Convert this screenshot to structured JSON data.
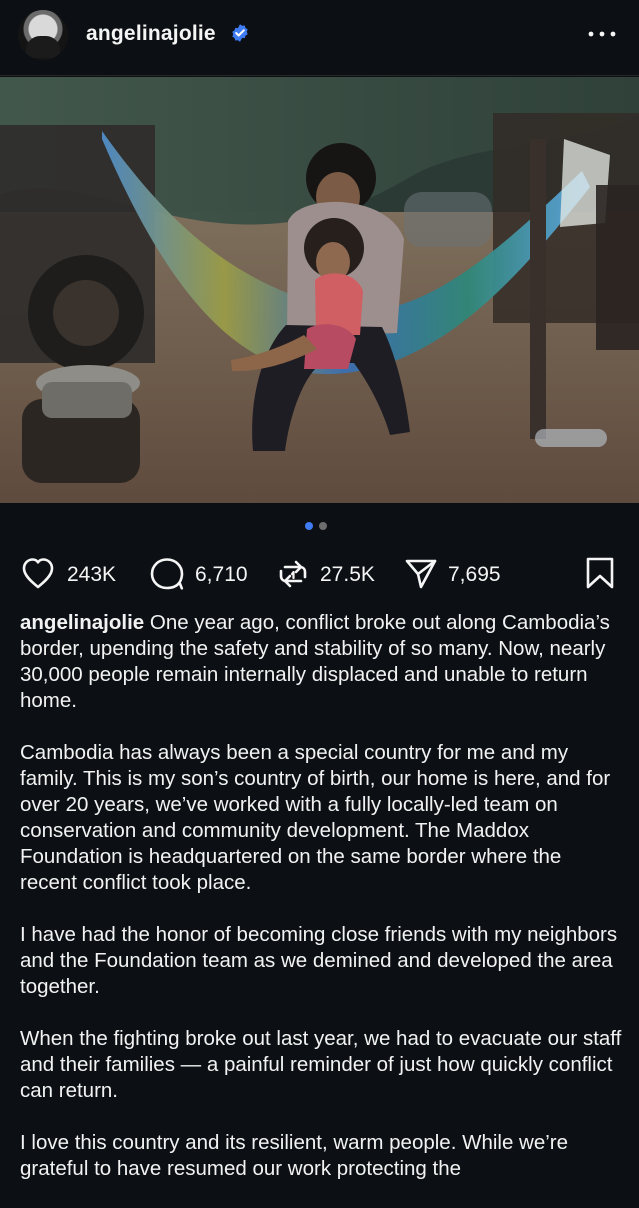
{
  "header": {
    "username": "angelinajolie",
    "verified_icon": "verified-badge-icon",
    "more_icon": "more-horizontal-icon"
  },
  "post": {
    "image_alt": "A mother holds a young child while sitting in a striped hammock under a tarp beside a truck, with a cooking pot on the ground.",
    "carousel": {
      "count": 2,
      "active_index": 0
    }
  },
  "actions": {
    "likes": "243K",
    "comments": "6,710",
    "reposts": "27.5K",
    "shares": "7,695",
    "icons": {
      "like": "heart-icon",
      "comment": "comment-icon",
      "repost": "repost-icon",
      "share": "share-icon",
      "save": "bookmark-icon"
    }
  },
  "caption": {
    "author": "angelinajolie",
    "first_paragraph": "One year ago, conflict broke out along Cambodia’s border, upending the safety and stability of so many. Now, nearly 30,000 people remain internally displaced and unable to return home.",
    "paragraph_2": "Cambodia has always been a special country for me and my family. This is my son’s country of birth, our home is here, and for over 20 years, we’ve worked with a fully locally-led team on conservation and community development. The Maddox Foundation is headquartered on the same border where the recent conflict took place.",
    "paragraph_3": "I have had the honor of becoming close friends with my neighbors and the Foundation team as we demined and developed the area together.",
    "paragraph_4": "When the fighting broke out last year, we had to evacuate our staff and their families — a painful reminder of just how quickly conflict can return.",
    "paragraph_5": "I love this country and its resilient, warm people. While we’re grateful to have resumed our work protecting the"
  },
  "colors": {
    "background": "#0c1014",
    "text": "#f5f5f5",
    "accent": "#3f7cf3",
    "divider": "#262626"
  }
}
